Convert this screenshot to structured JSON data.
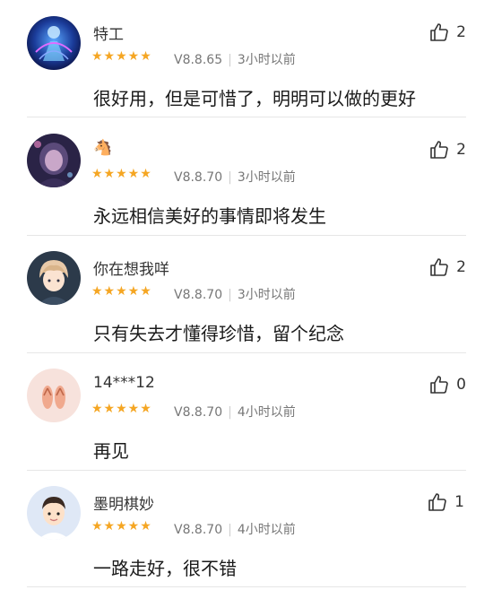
{
  "reviews": [
    {
      "username": "特工",
      "rating": 5,
      "version": "V8.8.65",
      "time": "3小时以前",
      "content": "很好用，但是可惜了，明明可以做的更好",
      "likes": "2",
      "avatar_icon": "blue-abstract-figure-avatar"
    },
    {
      "username": "🐴",
      "rating": 5,
      "version": "V8.8.70",
      "time": "3小时以前",
      "content": "永远相信美好的事情即将发生",
      "likes": "2",
      "avatar_icon": "dark-purple-portrait-avatar"
    },
    {
      "username": "你在想我咩",
      "rating": 5,
      "version": "V8.8.70",
      "time": "3小时以前",
      "content": "只有失去才懂得珍惜，留个纪念",
      "likes": "2",
      "avatar_icon": "anime-boy-avatar"
    },
    {
      "username": "14***12",
      "rating": 5,
      "version": "V8.8.70",
      "time": "4小时以前",
      "content": "再见",
      "likes": "0",
      "avatar_icon": "flip-flops-avatar"
    },
    {
      "username": "墨明棋妙",
      "rating": 5,
      "version": "V8.8.70",
      "time": "4小时以前",
      "content": "一路走好，很不错",
      "likes": "1",
      "avatar_icon": "cartoon-boy-avatar"
    }
  ],
  "stars_text": "★★★★★",
  "colors": {
    "star": "#f5a623",
    "meta_text": "#777777",
    "divider": "#e6e6e6"
  }
}
